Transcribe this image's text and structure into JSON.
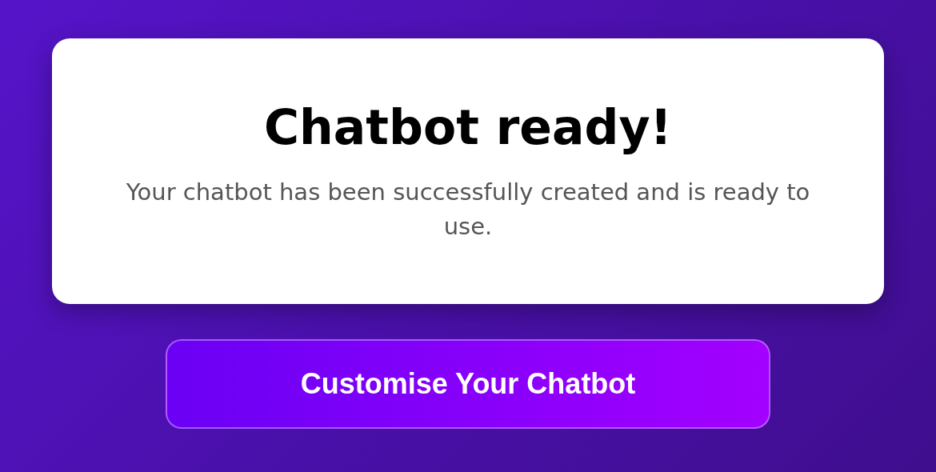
{
  "card": {
    "title": "Chatbot ready!",
    "message": "Your chatbot has been successfully created and is ready to use."
  },
  "button": {
    "label": "Customise Your Chatbot"
  }
}
